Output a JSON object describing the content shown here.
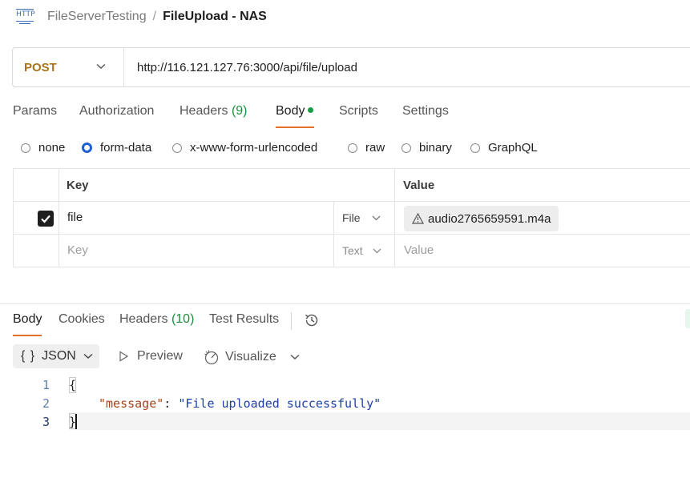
{
  "breadcrumb": {
    "icon_text": "HTTP",
    "parent": "FileServerTesting",
    "separator": "/",
    "current": "FileUpload - NAS"
  },
  "request": {
    "method": "POST",
    "url": "http://116.121.127.76:3000/api/file/upload"
  },
  "request_tabs": [
    {
      "label": "Params"
    },
    {
      "label": "Authorization"
    },
    {
      "label": "Headers",
      "count": "(9)"
    },
    {
      "label": "Body",
      "active": true
    },
    {
      "label": "Scripts"
    },
    {
      "label": "Settings"
    }
  ],
  "body_types": [
    {
      "label": "none",
      "selected": false
    },
    {
      "label": "form-data",
      "selected": true
    },
    {
      "label": "x-www-form-urlencoded",
      "selected": false
    },
    {
      "label": "raw",
      "selected": false
    },
    {
      "label": "binary",
      "selected": false
    },
    {
      "label": "GraphQL",
      "selected": false
    }
  ],
  "form_table": {
    "headers": {
      "key": "Key",
      "value": "Value"
    },
    "rows": [
      {
        "checked": true,
        "key": "file",
        "type": "File",
        "value": "audio2765659591.m4a"
      }
    ],
    "new_row": {
      "key_placeholder": "Key",
      "type": "Text",
      "value_placeholder": "Value"
    }
  },
  "response_tabs": [
    {
      "label": "Body",
      "active": true
    },
    {
      "label": "Cookies"
    },
    {
      "label": "Headers",
      "count": "(10)"
    },
    {
      "label": "Test Results"
    }
  ],
  "response_toolbar": {
    "format": "JSON",
    "format_icon": "{ }",
    "preview": "Preview",
    "visualize": "Visualize"
  },
  "response_code": {
    "line_numbers": [
      "1",
      "2",
      "3"
    ],
    "open_brace": "{",
    "close_brace": "}",
    "key": "\"message\"",
    "colon": ":",
    "value": "\"File uploaded successfully\""
  },
  "colors": {
    "method": "#a8731c",
    "accent": "#e0702a",
    "count": "#1a8f3c",
    "radio": "#1f5fd1",
    "json_key": "#a5421c",
    "json_string": "#1c3fa8"
  }
}
